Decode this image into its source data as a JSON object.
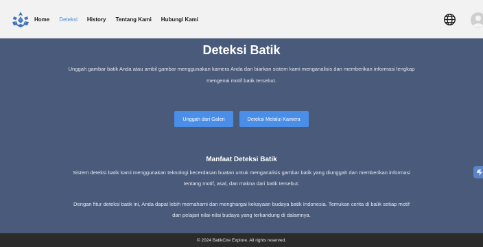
{
  "nav": {
    "items": [
      {
        "label": "Home"
      },
      {
        "label": "Deteksi"
      },
      {
        "label": "History"
      },
      {
        "label": "Tentang Kami"
      },
      {
        "label": "Hubungi Kami"
      }
    ],
    "active_index": 1
  },
  "icons": {
    "logo": "batik-logo-icon",
    "language": "globe-icon",
    "user": "user-avatar-icon",
    "side": "chat-widget-icon"
  },
  "hero": {
    "title": "Deteksi Batik",
    "description": "Unggah gambar batik Anda atau ambil gambar menggunakan kamera Anda dan biarkan sistem kami menganalisis dan memberikan informasi lengkap mengenai motif batik tersebut.",
    "buttons": {
      "gallery": "Unggah dari Galeri",
      "camera": "Deteksi Melalui Kamera"
    }
  },
  "benefits": {
    "title": "Manfaat Deteksi Batik",
    "paragraph1": "Sistem deteksi batik kami menggunakan teknologi kecerdasan buatan untuk menganalisis gambar batik yang diunggah dan memberikan informasi tentang motif, asal, dan makna dari batik tersebut.",
    "paragraph2": "Dengan fitur deteksi batik ini, Anda dapat lebih memahami dan menghargai kekayaan budaya batik Indonesia. Temukan cerita di balik setiap motif dan pelajari nilai-nilai budaya yang terkandung di dalamnya."
  },
  "footer": {
    "text": "© 2024 BatikCire Explore. All rights reserved."
  },
  "colors": {
    "navbar_bg": "#f2f2f2",
    "main_bg": "#4a5a7a",
    "accent": "#4a8ee8",
    "active_link": "#4a90d9",
    "footer_bg": "#2b2b2b"
  }
}
